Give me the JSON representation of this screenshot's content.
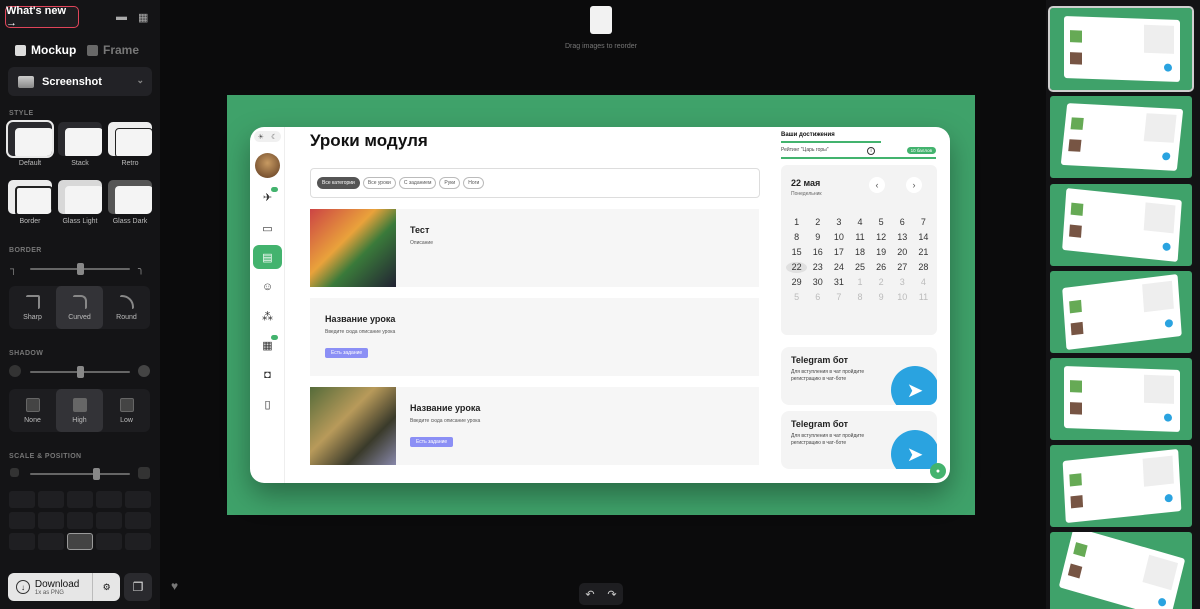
{
  "header": {
    "whats_new": "What's new →",
    "chat_icon": "chat-icon",
    "apps_icon": "grid-icon"
  },
  "tabs": [
    {
      "label": "Mockup",
      "active": true
    },
    {
      "label": "Frame",
      "active": false
    }
  ],
  "device_select": {
    "value": "Screenshot"
  },
  "sections": {
    "style": "STYLE",
    "border": "BORDER",
    "shadow": "SHADOW",
    "scale": "SCALE & POSITION"
  },
  "styles": [
    {
      "label": "Default",
      "selected": true
    },
    {
      "label": "Stack"
    },
    {
      "label": "Retro"
    },
    {
      "label": "Border"
    },
    {
      "label": "Glass Light"
    },
    {
      "label": "Glass Dark"
    }
  ],
  "border_options": [
    {
      "label": "Sharp"
    },
    {
      "label": "Curved",
      "selected": true
    },
    {
      "label": "Round"
    }
  ],
  "shadow_options": [
    {
      "label": "None"
    },
    {
      "label": "High",
      "selected": true
    },
    {
      "label": "Low"
    }
  ],
  "border_level": 0.5,
  "shadow_level": 0.5,
  "scale_level": 0.66,
  "download": {
    "label": "Download",
    "sub": "1x as PNG"
  },
  "canvas": {
    "reorder_hint": "Drag images to reorder",
    "background": "#3fa26a"
  },
  "mock": {
    "title": "Уроки модуля",
    "filters": [
      {
        "label": "Все категории",
        "active": true
      },
      {
        "label": "Все уроки"
      },
      {
        "label": "С заданием"
      },
      {
        "label": "Руки"
      },
      {
        "label": "Ноги"
      }
    ],
    "lessons": [
      {
        "title": "Тест",
        "desc": "Описание",
        "button": ""
      },
      {
        "title": "Название урока",
        "desc": "Введите сюда описание урока",
        "button": "Есть задание"
      },
      {
        "title": "Название урока",
        "desc": "Введите сюда описание урока",
        "button": "Есть задание"
      }
    ],
    "achievements": {
      "title": "Ваши достижения",
      "rating": "Рейтинг \"Царь горы\"",
      "points": "10 баллов"
    },
    "calendar": {
      "date": "22 мая",
      "weekday": "Понедельник",
      "days": [
        "1",
        "2",
        "3",
        "4",
        "5",
        "6",
        "7",
        "8",
        "9",
        "10",
        "11",
        "12",
        "13",
        "14",
        "15",
        "16",
        "17",
        "18",
        "19",
        "20",
        "21",
        "22",
        "23",
        "24",
        "25",
        "26",
        "27",
        "28",
        "29",
        "30",
        "31",
        "1",
        "2",
        "3",
        "4",
        "5",
        "6",
        "7",
        "8",
        "9",
        "10",
        "11"
      ],
      "today": "22"
    },
    "telegram": [
      {
        "title": "Telegram бот",
        "desc": "Для вступления в чат пройдите регистрацию в чат-боте"
      },
      {
        "title": "Telegram бот",
        "desc": "Для вступления в чат пройдите регистрацию в чат-боте"
      }
    ]
  }
}
